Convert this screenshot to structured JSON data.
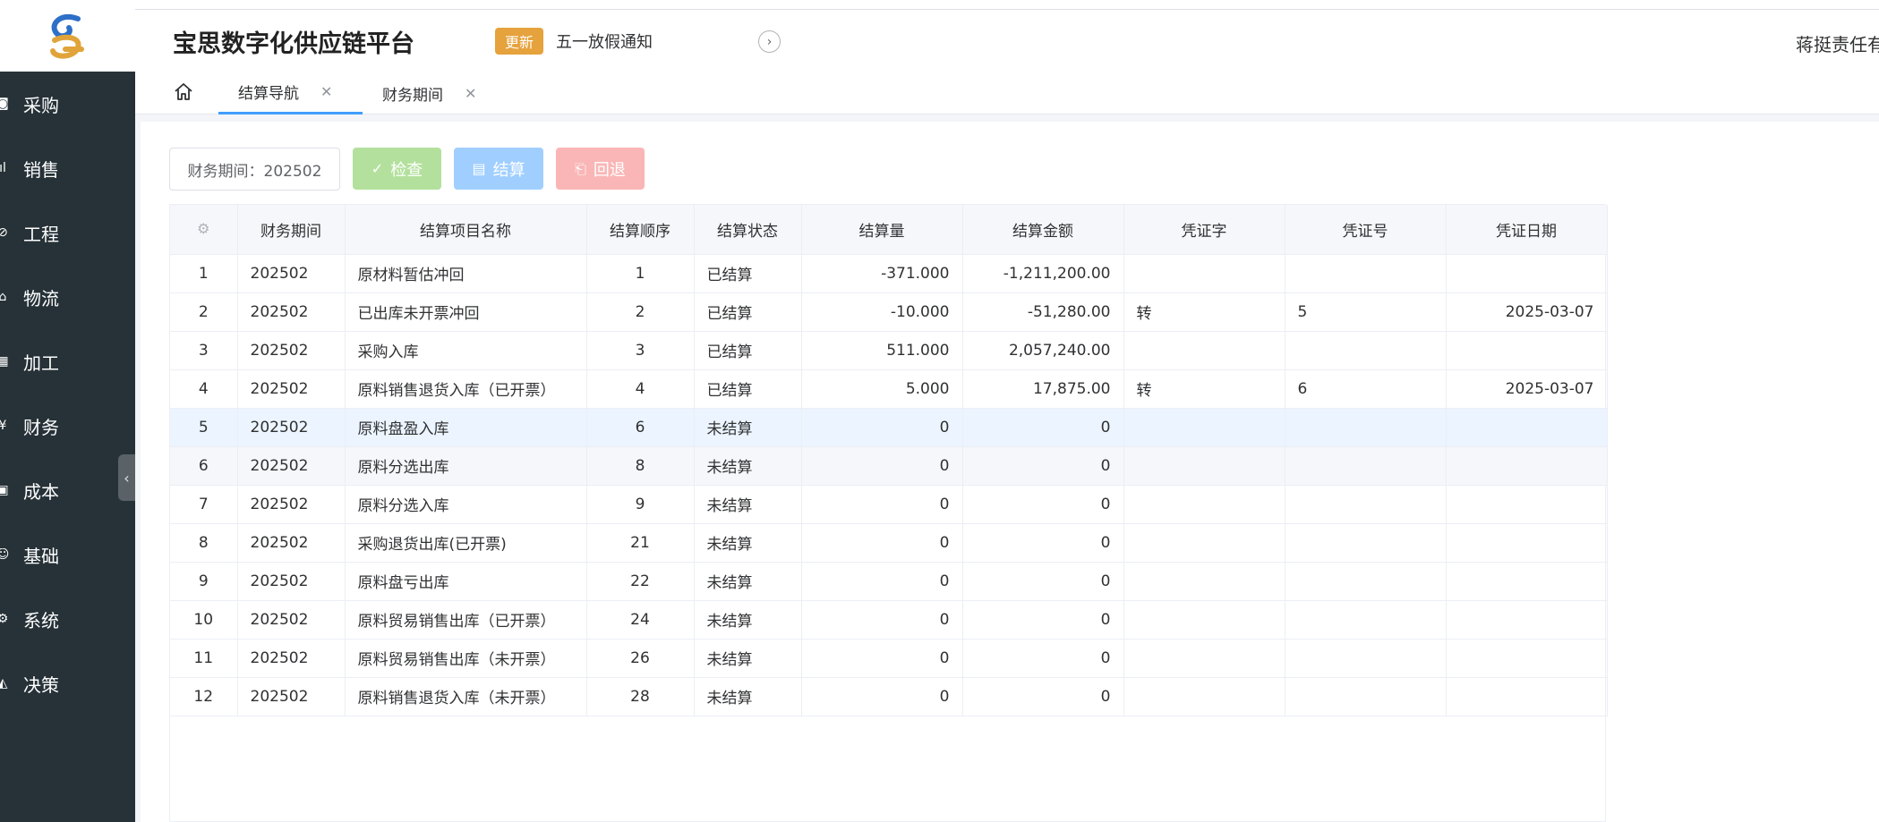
{
  "app": {
    "title": "宝思数字化供应链平台",
    "update_badge": "更新",
    "notice": "五一放假通知",
    "user": "蒋挺责任有限公司"
  },
  "colors": {
    "sidebar_bg": "#263238",
    "accent": "#409eff",
    "badge": "#e6a23c",
    "btn_check": "#b3e19d",
    "btn_settle": "#a0cfff",
    "btn_back": "#fab6b6"
  },
  "sidebar": {
    "items": [
      {
        "label": "采购",
        "icon": "purchase-icon"
      },
      {
        "label": "销售",
        "icon": "sales-chart-icon"
      },
      {
        "label": "工程",
        "icon": "engineering-icon"
      },
      {
        "label": "物流",
        "icon": "logistics-home-icon"
      },
      {
        "label": "加工",
        "icon": "processing-icon"
      },
      {
        "label": "财务",
        "icon": "yen-icon"
      },
      {
        "label": "成本",
        "icon": "cost-icon"
      },
      {
        "label": "基础",
        "icon": "smile-icon"
      },
      {
        "label": "系统",
        "icon": "gear-icon"
      },
      {
        "label": "决策",
        "icon": "decision-chart-icon"
      }
    ]
  },
  "tabs": [
    {
      "label": "结算导航",
      "active": true
    },
    {
      "label": "财务期间",
      "active": false
    }
  ],
  "toolbar": {
    "period_label": "财务期间：202502",
    "check_label": "检查",
    "settle_label": "结算",
    "rollback_label": "回退"
  },
  "table": {
    "columns": [
      "财务期间",
      "结算项目名称",
      "结算顺序",
      "结算状态",
      "结算量",
      "结算金额",
      "凭证字",
      "凭证号",
      "凭证日期"
    ],
    "rows": [
      {
        "no": "1",
        "period": "202502",
        "name": "原材料暂估冲回",
        "order": "1",
        "status": "已结算",
        "qty": "-371.000",
        "amount": "-1,211,200.00",
        "voucher_word": "",
        "voucher_no": "",
        "voucher_date": ""
      },
      {
        "no": "2",
        "period": "202502",
        "name": "已出库未开票冲回",
        "order": "2",
        "status": "已结算",
        "qty": "-10.000",
        "amount": "-51,280.00",
        "voucher_word": "转",
        "voucher_no": "5",
        "voucher_date": "2025-03-07"
      },
      {
        "no": "3",
        "period": "202502",
        "name": "采购入库",
        "order": "3",
        "status": "已结算",
        "qty": "511.000",
        "amount": "2,057,240.00",
        "voucher_word": "",
        "voucher_no": "",
        "voucher_date": ""
      },
      {
        "no": "4",
        "period": "202502",
        "name": "原料销售退货入库（已开票）",
        "order": "4",
        "status": "已结算",
        "qty": "5.000",
        "amount": "17,875.00",
        "voucher_word": "转",
        "voucher_no": "6",
        "voucher_date": "2025-03-07"
      },
      {
        "no": "5",
        "period": "202502",
        "name": "原料盘盈入库",
        "order": "6",
        "status": "未结算",
        "qty": "0",
        "amount": "0",
        "voucher_word": "",
        "voucher_no": "",
        "voucher_date": ""
      },
      {
        "no": "6",
        "period": "202502",
        "name": "原料分选出库",
        "order": "8",
        "status": "未结算",
        "qty": "0",
        "amount": "0",
        "voucher_word": "",
        "voucher_no": "",
        "voucher_date": ""
      },
      {
        "no": "7",
        "period": "202502",
        "name": "原料分选入库",
        "order": "9",
        "status": "未结算",
        "qty": "0",
        "amount": "0",
        "voucher_word": "",
        "voucher_no": "",
        "voucher_date": ""
      },
      {
        "no": "8",
        "period": "202502",
        "name": "采购退货出库(已开票)",
        "order": "21",
        "status": "未结算",
        "qty": "0",
        "amount": "0",
        "voucher_word": "",
        "voucher_no": "",
        "voucher_date": ""
      },
      {
        "no": "9",
        "period": "202502",
        "name": "原料盘亏出库",
        "order": "22",
        "status": "未结算",
        "qty": "0",
        "amount": "0",
        "voucher_word": "",
        "voucher_no": "",
        "voucher_date": ""
      },
      {
        "no": "10",
        "period": "202502",
        "name": "原料贸易销售出库（已开票）",
        "order": "24",
        "status": "未结算",
        "qty": "0",
        "amount": "0",
        "voucher_word": "",
        "voucher_no": "",
        "voucher_date": ""
      },
      {
        "no": "11",
        "period": "202502",
        "name": "原料贸易销售出库（未开票）",
        "order": "26",
        "status": "未结算",
        "qty": "0",
        "amount": "0",
        "voucher_word": "",
        "voucher_no": "",
        "voucher_date": ""
      },
      {
        "no": "12",
        "period": "202502",
        "name": "原料销售退货入库（未开票）",
        "order": "28",
        "status": "未结算",
        "qty": "0",
        "amount": "0",
        "voucher_word": "",
        "voucher_no": "",
        "voucher_date": ""
      }
    ]
  }
}
